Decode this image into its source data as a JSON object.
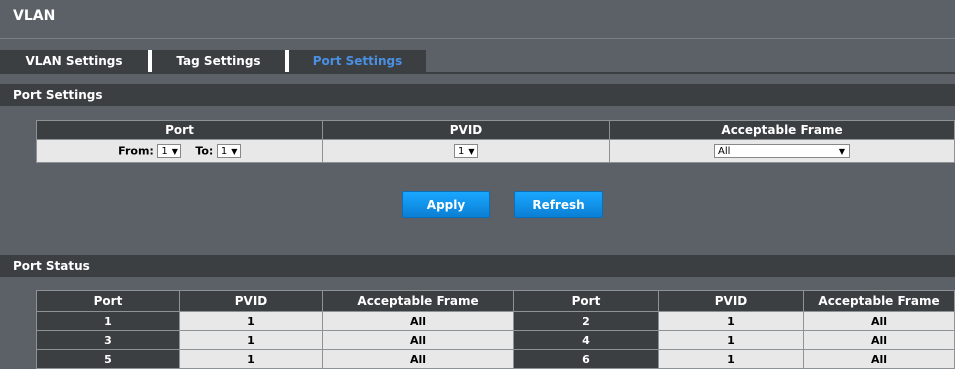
{
  "page": {
    "title": "VLAN"
  },
  "tabs": [
    {
      "label": "VLAN Settings",
      "active": false
    },
    {
      "label": "Tag Settings",
      "active": false
    },
    {
      "label": "Port Settings",
      "active": true
    }
  ],
  "port_settings": {
    "section_title": "Port Settings",
    "headers": {
      "port": "Port",
      "pvid": "PVID",
      "frame": "Acceptable Frame"
    },
    "from_label": "From:",
    "to_label": "To:",
    "from_value": "1",
    "to_value": "1",
    "pvid_value": "1",
    "frame_value": "All"
  },
  "buttons": {
    "apply": "Apply",
    "refresh": "Refresh"
  },
  "port_status": {
    "section_title": "Port Status",
    "headers": [
      "Port",
      "PVID",
      "Acceptable Frame",
      "Port",
      "PVID",
      "Acceptable Frame"
    ],
    "rows": [
      [
        "1",
        "1",
        "All",
        "2",
        "1",
        "All"
      ],
      [
        "3",
        "1",
        "All",
        "4",
        "1",
        "All"
      ],
      [
        "5",
        "1",
        "All",
        "6",
        "1",
        "All"
      ]
    ]
  },
  "colors": {
    "background": "#5b6166",
    "bar": "#3c3f42",
    "active_tab": "#4a90e2",
    "button": "#1a9af0"
  }
}
